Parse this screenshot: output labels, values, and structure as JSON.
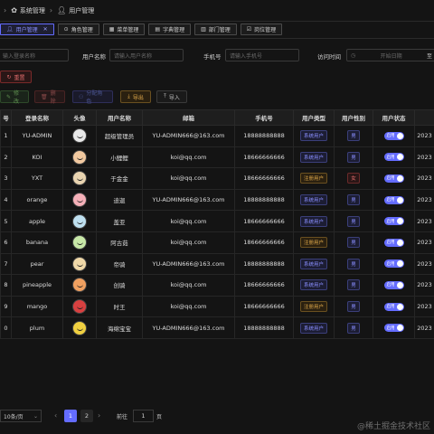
{
  "breadcrumb": {
    "system": "系统管理",
    "user": "用户管理"
  },
  "tabs": [
    {
      "label": "用户管理",
      "active": true,
      "icon": "user-icon"
    },
    {
      "label": "角色管理",
      "active": false,
      "icon": "role-icon"
    },
    {
      "label": "菜单管理",
      "active": false,
      "icon": "menu-icon"
    },
    {
      "label": "字典管理",
      "active": false,
      "icon": "dict-icon"
    },
    {
      "label": "部门管理",
      "active": false,
      "icon": "dept-icon"
    },
    {
      "label": "岗位管理",
      "active": false,
      "icon": "post-icon"
    }
  ],
  "filters": {
    "login_placeholder": "输入登录名称",
    "name_label": "用户名称",
    "name_placeholder": "请输入用户名称",
    "phone_label": "手机号",
    "phone_placeholder": "请输入手机号",
    "time_label": "访问时间",
    "start_placeholder": "开始日期",
    "to": "至"
  },
  "buttons": {
    "reset": "重置",
    "edit": "修改",
    "delete": "删除",
    "assign": "分配角色",
    "export": "导出",
    "import": "导入"
  },
  "table": {
    "headers": [
      "号",
      "登录名称",
      "头像",
      "用户名称",
      "邮箱",
      "手机号",
      "用户类型",
      "用户性别",
      "用户状态",
      ""
    ],
    "rows": [
      {
        "no": "1",
        "login": "YU-ADMIN",
        "avatar_color": "#e8e8e8",
        "name": "超级管理员",
        "email": "YU-ADMIN666@163.com",
        "phone": "18888888888",
        "type": "系统用户",
        "gender": "男",
        "status": "启用",
        "date": "2023"
      },
      {
        "no": "2",
        "login": "KOI",
        "avatar_color": "#f2c9a0",
        "name": "小鲤鲤",
        "email": "koi@qq.com",
        "phone": "18666666666",
        "type": "系统用户",
        "gender": "男",
        "status": "启用",
        "date": "2023"
      },
      {
        "no": "3",
        "login": "YXT",
        "avatar_color": "#e9d4b0",
        "name": "于金金",
        "email": "koi@qq.com",
        "phone": "18666666666",
        "type": "注册用户",
        "gender": "女",
        "status": "启用",
        "date": "2023"
      },
      {
        "no": "4",
        "login": "orange",
        "avatar_color": "#f5b0b8",
        "name": "迪迦",
        "email": "YU-ADMIN666@163.com",
        "phone": "18888888888",
        "type": "系统用户",
        "gender": "男",
        "status": "启用",
        "date": "2023"
      },
      {
        "no": "5",
        "login": "apple",
        "avatar_color": "#bfe0f0",
        "name": "盖亚",
        "email": "koi@qq.com",
        "phone": "18666666666",
        "type": "系统用户",
        "gender": "男",
        "status": "启用",
        "date": "2023"
      },
      {
        "no": "6",
        "login": "banana",
        "avatar_color": "#c8e8a8",
        "name": "阿古茹",
        "email": "koi@qq.com",
        "phone": "18666666666",
        "type": "注册用户",
        "gender": "男",
        "status": "启用",
        "date": "2023"
      },
      {
        "no": "7",
        "login": "pear",
        "avatar_color": "#f0d8a8",
        "name": "帝骑",
        "email": "YU-ADMIN666@163.com",
        "phone": "18888888888",
        "type": "系统用户",
        "gender": "男",
        "status": "启用",
        "date": "2023"
      },
      {
        "no": "8",
        "login": "pineapple",
        "avatar_color": "#f0a060",
        "name": "创骑",
        "email": "koi@qq.com",
        "phone": "18666666666",
        "type": "系统用户",
        "gender": "男",
        "status": "启用",
        "date": "2023"
      },
      {
        "no": "9",
        "login": "mango",
        "avatar_color": "#d84040",
        "name": "时王",
        "email": "koi@qq.com",
        "phone": "18666666666",
        "type": "注册用户",
        "gender": "男",
        "status": "启用",
        "date": "2023"
      },
      {
        "no": "0",
        "login": "plum",
        "avatar_color": "#f0d040",
        "name": "海绵宝宝",
        "email": "YU-ADMIN666@163.com",
        "phone": "18888888888",
        "type": "系统用户",
        "gender": "男",
        "status": "启用",
        "date": "2023"
      }
    ]
  },
  "pagination": {
    "size": "10条/页",
    "pages": [
      "1",
      "2"
    ],
    "jump_label": "前往",
    "jump_value": "1",
    "page_unit": "页"
  },
  "watermark": "@稀土掘金技术社区",
  "colors": {
    "accent": "#646cff",
    "danger": "#e06c6c",
    "warning": "#e0a94a"
  }
}
